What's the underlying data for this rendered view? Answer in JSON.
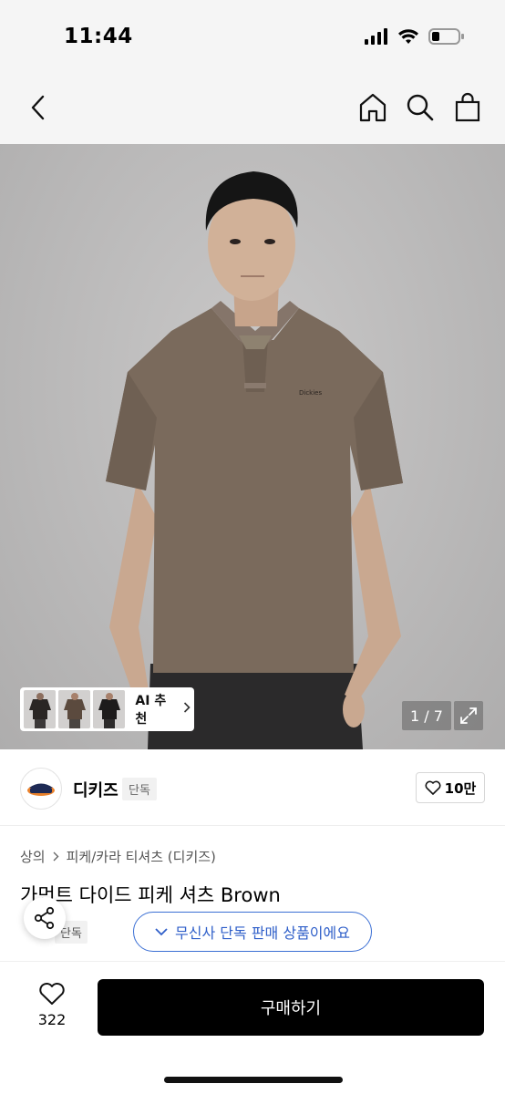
{
  "status_bar": {
    "time": "11:44"
  },
  "nav": {
    "icons": [
      "back-chevron-icon",
      "home-icon",
      "search-icon",
      "shopping-bag-icon"
    ]
  },
  "gallery": {
    "ai_recommend_label": "AI 추천",
    "counter": "1 / 7",
    "thumbnails": 3
  },
  "brand": {
    "name": "디키즈",
    "badge": "단독",
    "likes": "10만",
    "logo_text": "Dickies"
  },
  "product": {
    "breadcrumb": [
      "상의",
      "피케/카라 티셔츠 (디키즈)"
    ],
    "title": "가먼트 다이드 피케 셔츠 Brown",
    "exclusive_badge": "단독",
    "exclusive_notice": "무신사 단독 판매 상품이에요"
  },
  "bottom_bar": {
    "wish_count": "322",
    "buy_label": "구매하기"
  },
  "colors": {
    "accent_blue": "#3b6fd4",
    "buy_button": "#000000",
    "shirt_brown": "#7a6a5c"
  }
}
